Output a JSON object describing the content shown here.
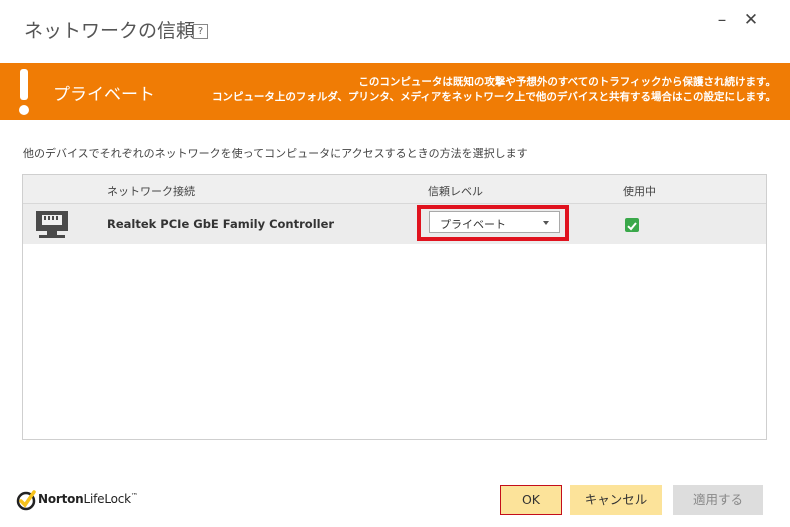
{
  "window": {
    "title": "ネットワークの信頼",
    "help_label": "?",
    "minimize_label": "–",
    "close_label": "✕"
  },
  "banner": {
    "title": "プライベート",
    "message_line1": "このコンピュータは既知の攻撃や予想外のすべてのトラフィックから保護され続けます。",
    "message_line2": "コンピュータ上のフォルダ、プリンタ、メディアをネットワーク上で他のデバイスと共有する場合はこの設定にします。",
    "color": "#f07c05"
  },
  "instruction": "他のデバイスでそれぞれのネットワークを使ってコンピュータにアクセスするときの方法を選択します",
  "table": {
    "headers": {
      "connection": "ネットワーク接続",
      "trust_level": "信頼レベル",
      "in_use": "使用中"
    },
    "rows": [
      {
        "icon": "network-adapter-icon",
        "name": "Realtek PCIe GbE Family Controller",
        "trust_level": "プライベート",
        "in_use": true
      }
    ]
  },
  "logo": {
    "brand_bold": "Norton",
    "brand_rest": "LifeLock",
    "trademark": "™"
  },
  "buttons": {
    "ok": "OK",
    "cancel": "キャンセル",
    "apply": "適用する"
  },
  "colors": {
    "highlight": "#e0121e",
    "check": "#3aa84a",
    "button_primary": "#fce39a"
  }
}
